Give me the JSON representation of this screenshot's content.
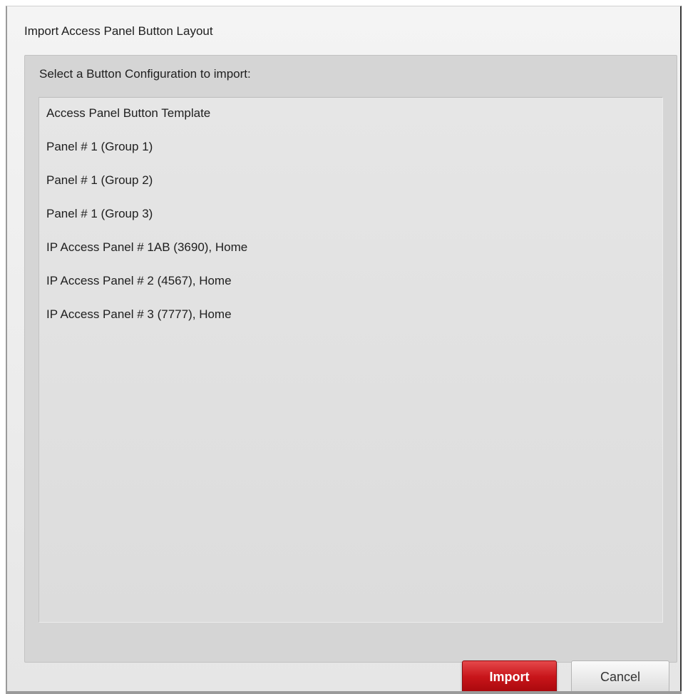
{
  "dialog": {
    "title": "Import Access Panel Button Layout",
    "prompt": "Select a Button Configuration to import:",
    "items": [
      "Access Panel Button Template",
      "Panel # 1 (Group 1)",
      "Panel # 1 (Group 2)",
      "Panel # 1 (Group 3)",
      "IP Access Panel # 1AB (3690), Home",
      "IP Access Panel # 2 (4567), Home",
      "IP Access Panel # 3 (7777), Home"
    ],
    "buttons": {
      "import_label": "Import",
      "cancel_label": "Cancel"
    }
  },
  "colors": {
    "import_button": "#c8151a",
    "panel_background": "#d5d5d5",
    "list_background": "#e2e2e2"
  }
}
